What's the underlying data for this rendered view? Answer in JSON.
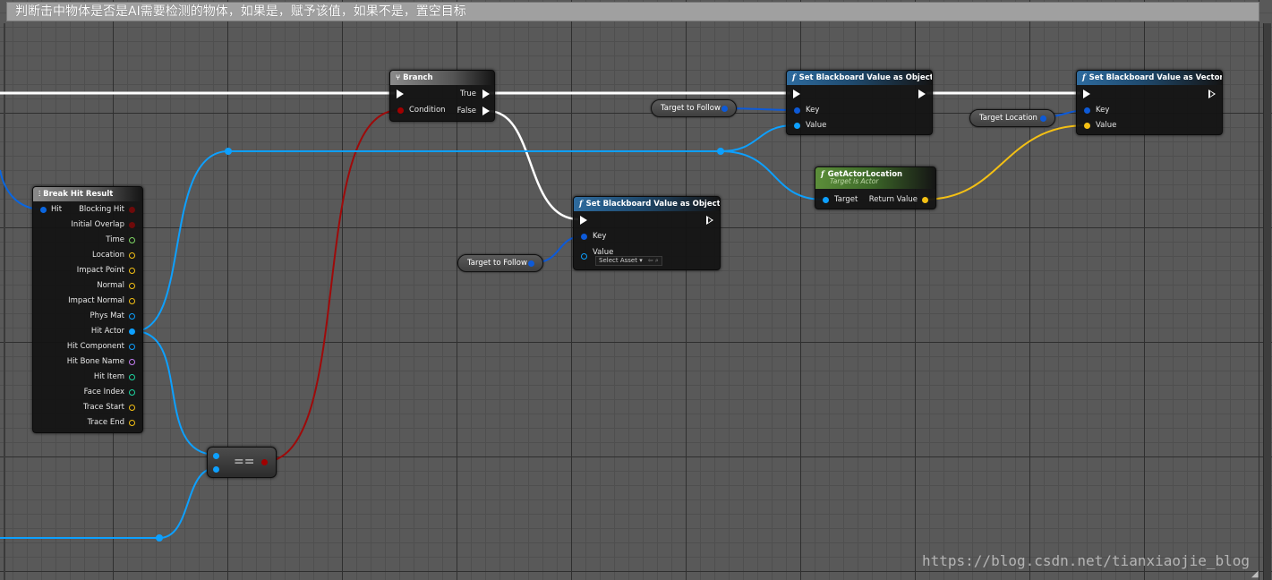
{
  "comment": {
    "text": "判断击中物体是否是AI需要检测的物体，如果是，赋予该值，如果不是，置空目标"
  },
  "colors": {
    "exec": "#ffffff",
    "object_pin": "#0da0ff",
    "blackboard_key_pin": "#0d5ad8",
    "bool_pin": "#a10000",
    "vector_pin": "#f4c014",
    "float_pin": "#7ed664",
    "name_pin": "#c57ef5",
    "int_pin": "#1dd5a0",
    "struct_pin": "#0a66e0"
  },
  "nodes": {
    "break_hit": {
      "title": "Break Hit Result",
      "input": "Hit",
      "outputs": [
        "Blocking Hit",
        "Initial Overlap",
        "Time",
        "Location",
        "Impact Point",
        "Normal",
        "Impact Normal",
        "Phys Mat",
        "Hit Actor",
        "Hit Component",
        "Hit Bone Name",
        "Hit Item",
        "Face Index",
        "Trace Start",
        "Trace End"
      ]
    },
    "branch": {
      "title": "Branch",
      "condition": "Condition",
      "true_label": "True",
      "false_label": "False"
    },
    "set_obj_top": {
      "title": "Set Blackboard Value as Object",
      "key": "Key",
      "value": "Value"
    },
    "set_obj_mid": {
      "title": "Set Blackboard Value as Object",
      "key": "Key",
      "value": "Value",
      "select_asset": "Select Asset"
    },
    "set_vec": {
      "title": "Set Blackboard Value as Vector",
      "key": "Key",
      "value": "Value"
    },
    "get_actor_location": {
      "title": "GetActorLocation",
      "subtitle": "Target is Actor",
      "target": "Target",
      "return_value": "Return Value"
    },
    "equal": {
      "symbol": "=="
    }
  },
  "getters": {
    "target_follow_top": "Target to Follow",
    "target_follow_mid": "Target to Follow",
    "target_location": "Target Location"
  },
  "watermark": "https://blog.csdn.net/tianxiaojie_blog"
}
